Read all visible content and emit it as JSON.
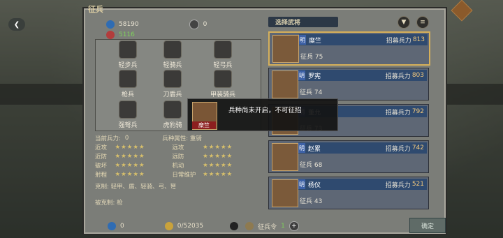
{
  "panel": {
    "title": "征兵"
  },
  "resources": {
    "troops": "58190",
    "recruit_cap": "5116",
    "player_count": "0"
  },
  "troops_grid": [
    {
      "label": "轻步兵"
    },
    {
      "label": "轻骑兵"
    },
    {
      "label": "轻弓兵"
    },
    {
      "label": "枪兵"
    },
    {
      "label": "刀盾兵"
    },
    {
      "label": "甲装骑兵"
    },
    {
      "label": "强弩兵"
    },
    {
      "label": "虎豹骑"
    }
  ],
  "stats": {
    "current_force_label": "当前兵力:",
    "current_force_value": "0",
    "troop_type_label": "兵种属性: 重骑",
    "left": [
      {
        "name": "近攻",
        "stars": "★★★★★"
      },
      {
        "name": "近防",
        "stars": "★★★★★"
      },
      {
        "name": "破坏",
        "stars": "★★★★★"
      },
      {
        "name": "射程",
        "stars": "★★★★★"
      }
    ],
    "right": [
      {
        "name": "远攻",
        "stars": "★★★★★"
      },
      {
        "name": "远防",
        "stars": "★★★★★"
      },
      {
        "name": "机动",
        "stars": "★★★★★"
      },
      {
        "name": "日常维护",
        "stars": "★★★★★"
      }
    ],
    "counter": "克制: 轻甲、盾、轻骑、弓、弩",
    "countered": "被克制: 枪"
  },
  "list": {
    "header": "选择武将",
    "filter_icon": "funnel-icon",
    "menu_icon": "list-icon",
    "cards": [
      {
        "grade": "明",
        "name": "糜竺",
        "label": "招募兵力",
        "value": "813",
        "sub": "征兵 75",
        "selected": true
      },
      {
        "grade": "明",
        "name": "罗宪",
        "label": "招募兵力",
        "value": "803",
        "sub": "征兵 74",
        "selected": false
      },
      {
        "grade": "明",
        "name": "董允",
        "label": "招募兵力",
        "value": "792",
        "sub": "征兵 73",
        "selected": false
      },
      {
        "grade": "明",
        "name": "赵累",
        "label": "招募兵力",
        "value": "742",
        "sub": "征兵 68",
        "selected": false
      },
      {
        "grade": "明",
        "name": "杨仪",
        "label": "招募兵力",
        "value": "521",
        "sub": "征兵 43",
        "selected": false
      }
    ]
  },
  "tooltip": {
    "name": "糜竺",
    "message": "兵种尚未开启，不可征招"
  },
  "bottom": {
    "troops": "0",
    "gold": "0/52035",
    "order_label": "征兵令",
    "order_value": "1"
  },
  "confirm": {
    "label": "确定"
  },
  "colors": {
    "accent": "#d6b05a",
    "panel": "#7b7d78"
  }
}
